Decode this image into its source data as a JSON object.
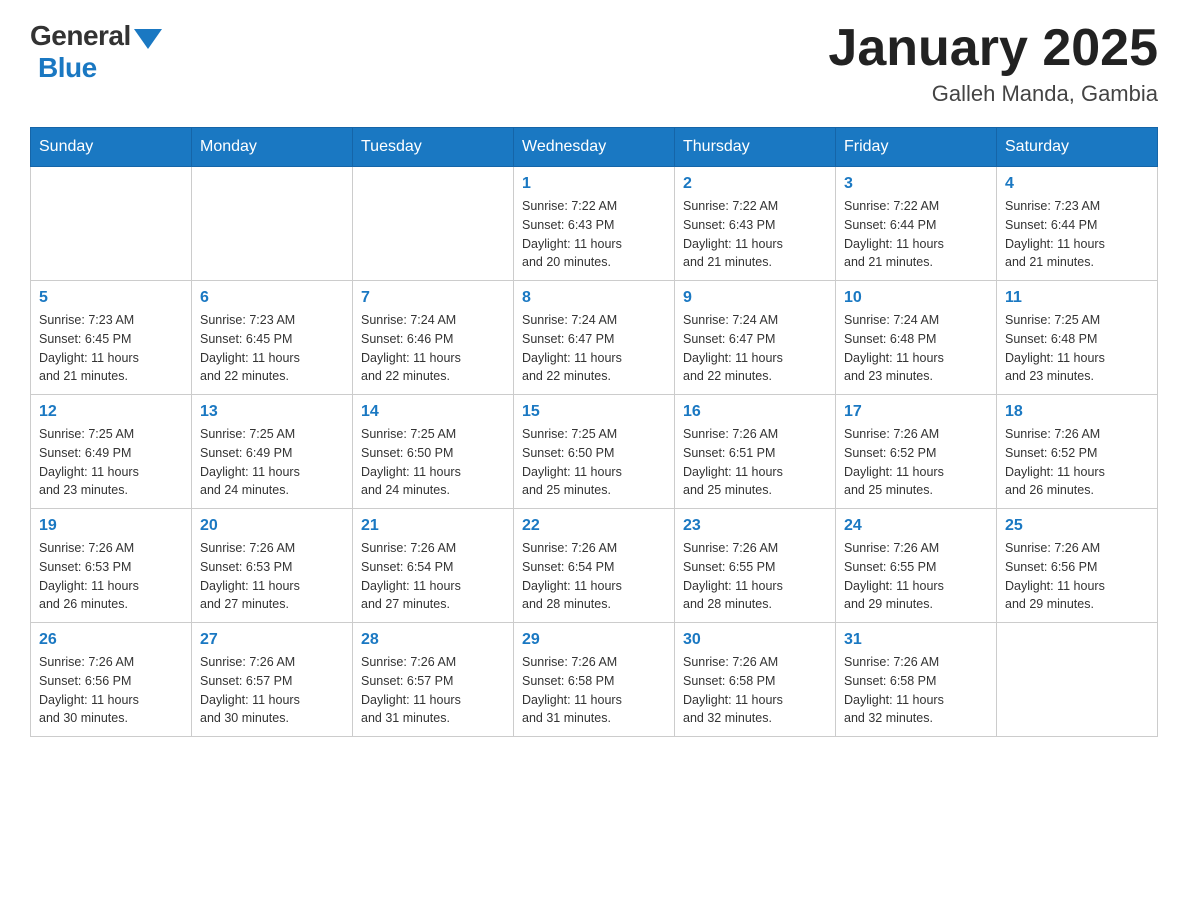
{
  "header": {
    "logo_general": "General",
    "logo_blue": "Blue",
    "title": "January 2025",
    "subtitle": "Galleh Manda, Gambia"
  },
  "days_of_week": [
    "Sunday",
    "Monday",
    "Tuesday",
    "Wednesday",
    "Thursday",
    "Friday",
    "Saturday"
  ],
  "weeks": [
    [
      {
        "day": "",
        "info": ""
      },
      {
        "day": "",
        "info": ""
      },
      {
        "day": "",
        "info": ""
      },
      {
        "day": "1",
        "info": "Sunrise: 7:22 AM\nSunset: 6:43 PM\nDaylight: 11 hours\nand 20 minutes."
      },
      {
        "day": "2",
        "info": "Sunrise: 7:22 AM\nSunset: 6:43 PM\nDaylight: 11 hours\nand 21 minutes."
      },
      {
        "day": "3",
        "info": "Sunrise: 7:22 AM\nSunset: 6:44 PM\nDaylight: 11 hours\nand 21 minutes."
      },
      {
        "day": "4",
        "info": "Sunrise: 7:23 AM\nSunset: 6:44 PM\nDaylight: 11 hours\nand 21 minutes."
      }
    ],
    [
      {
        "day": "5",
        "info": "Sunrise: 7:23 AM\nSunset: 6:45 PM\nDaylight: 11 hours\nand 21 minutes."
      },
      {
        "day": "6",
        "info": "Sunrise: 7:23 AM\nSunset: 6:45 PM\nDaylight: 11 hours\nand 22 minutes."
      },
      {
        "day": "7",
        "info": "Sunrise: 7:24 AM\nSunset: 6:46 PM\nDaylight: 11 hours\nand 22 minutes."
      },
      {
        "day": "8",
        "info": "Sunrise: 7:24 AM\nSunset: 6:47 PM\nDaylight: 11 hours\nand 22 minutes."
      },
      {
        "day": "9",
        "info": "Sunrise: 7:24 AM\nSunset: 6:47 PM\nDaylight: 11 hours\nand 22 minutes."
      },
      {
        "day": "10",
        "info": "Sunrise: 7:24 AM\nSunset: 6:48 PM\nDaylight: 11 hours\nand 23 minutes."
      },
      {
        "day": "11",
        "info": "Sunrise: 7:25 AM\nSunset: 6:48 PM\nDaylight: 11 hours\nand 23 minutes."
      }
    ],
    [
      {
        "day": "12",
        "info": "Sunrise: 7:25 AM\nSunset: 6:49 PM\nDaylight: 11 hours\nand 23 minutes."
      },
      {
        "day": "13",
        "info": "Sunrise: 7:25 AM\nSunset: 6:49 PM\nDaylight: 11 hours\nand 24 minutes."
      },
      {
        "day": "14",
        "info": "Sunrise: 7:25 AM\nSunset: 6:50 PM\nDaylight: 11 hours\nand 24 minutes."
      },
      {
        "day": "15",
        "info": "Sunrise: 7:25 AM\nSunset: 6:50 PM\nDaylight: 11 hours\nand 25 minutes."
      },
      {
        "day": "16",
        "info": "Sunrise: 7:26 AM\nSunset: 6:51 PM\nDaylight: 11 hours\nand 25 minutes."
      },
      {
        "day": "17",
        "info": "Sunrise: 7:26 AM\nSunset: 6:52 PM\nDaylight: 11 hours\nand 25 minutes."
      },
      {
        "day": "18",
        "info": "Sunrise: 7:26 AM\nSunset: 6:52 PM\nDaylight: 11 hours\nand 26 minutes."
      }
    ],
    [
      {
        "day": "19",
        "info": "Sunrise: 7:26 AM\nSunset: 6:53 PM\nDaylight: 11 hours\nand 26 minutes."
      },
      {
        "day": "20",
        "info": "Sunrise: 7:26 AM\nSunset: 6:53 PM\nDaylight: 11 hours\nand 27 minutes."
      },
      {
        "day": "21",
        "info": "Sunrise: 7:26 AM\nSunset: 6:54 PM\nDaylight: 11 hours\nand 27 minutes."
      },
      {
        "day": "22",
        "info": "Sunrise: 7:26 AM\nSunset: 6:54 PM\nDaylight: 11 hours\nand 28 minutes."
      },
      {
        "day": "23",
        "info": "Sunrise: 7:26 AM\nSunset: 6:55 PM\nDaylight: 11 hours\nand 28 minutes."
      },
      {
        "day": "24",
        "info": "Sunrise: 7:26 AM\nSunset: 6:55 PM\nDaylight: 11 hours\nand 29 minutes."
      },
      {
        "day": "25",
        "info": "Sunrise: 7:26 AM\nSunset: 6:56 PM\nDaylight: 11 hours\nand 29 minutes."
      }
    ],
    [
      {
        "day": "26",
        "info": "Sunrise: 7:26 AM\nSunset: 6:56 PM\nDaylight: 11 hours\nand 30 minutes."
      },
      {
        "day": "27",
        "info": "Sunrise: 7:26 AM\nSunset: 6:57 PM\nDaylight: 11 hours\nand 30 minutes."
      },
      {
        "day": "28",
        "info": "Sunrise: 7:26 AM\nSunset: 6:57 PM\nDaylight: 11 hours\nand 31 minutes."
      },
      {
        "day": "29",
        "info": "Sunrise: 7:26 AM\nSunset: 6:58 PM\nDaylight: 11 hours\nand 31 minutes."
      },
      {
        "day": "30",
        "info": "Sunrise: 7:26 AM\nSunset: 6:58 PM\nDaylight: 11 hours\nand 32 minutes."
      },
      {
        "day": "31",
        "info": "Sunrise: 7:26 AM\nSunset: 6:58 PM\nDaylight: 11 hours\nand 32 minutes."
      },
      {
        "day": "",
        "info": ""
      }
    ]
  ]
}
